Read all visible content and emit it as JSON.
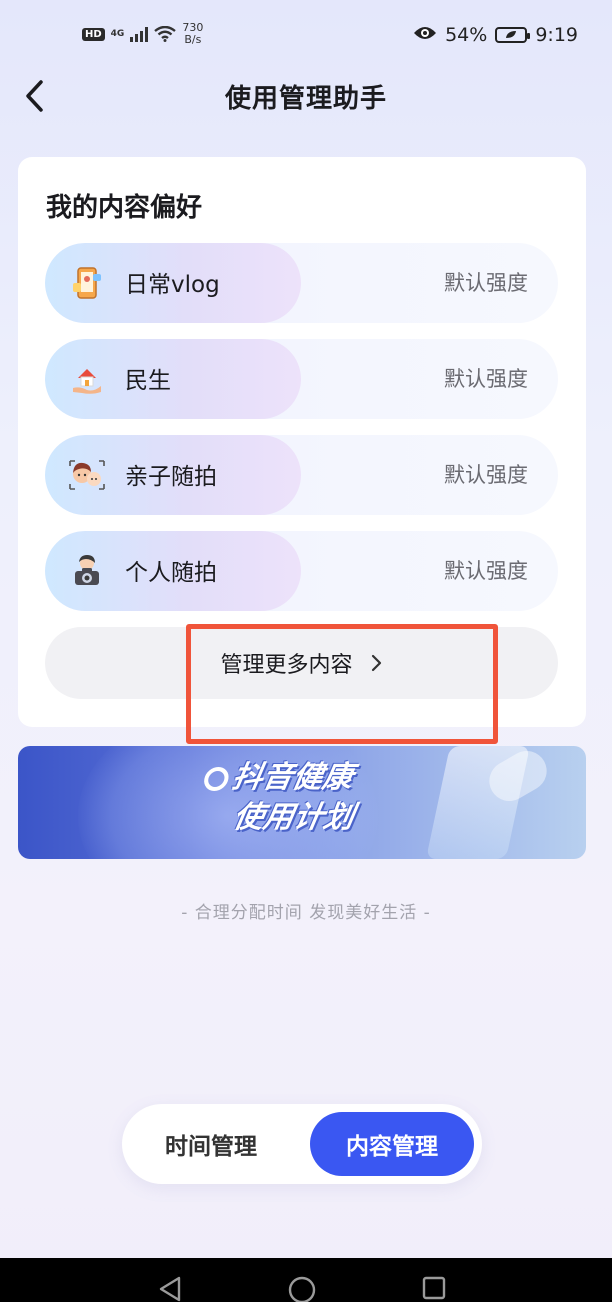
{
  "status_bar": {
    "hd": "HD",
    "network": "4G",
    "speed_value": "730",
    "speed_unit": "B/s",
    "battery": "54%",
    "time": "9:19",
    "icons": [
      "signal-icon",
      "wifi-icon",
      "eye-icon",
      "battery-icon"
    ]
  },
  "nav": {
    "title": "使用管理助手",
    "back_icon": "chevron-left-icon"
  },
  "preferences": {
    "title": "我的内容偏好",
    "items": [
      {
        "label": "日常vlog",
        "strength": "默认强度",
        "icon": "phone-vlog-icon"
      },
      {
        "label": "民生",
        "strength": "默认强度",
        "icon": "house-hand-icon"
      },
      {
        "label": "亲子随拍",
        "strength": "默认强度",
        "icon": "parent-child-icon"
      },
      {
        "label": "个人随拍",
        "strength": "默认强度",
        "icon": "camera-person-icon"
      }
    ],
    "more_label": "管理更多内容",
    "more_icon": "chevron-right-icon"
  },
  "banner": {
    "line1": "抖音健康",
    "line2": "使用计划"
  },
  "slogan": "- 合理分配时间 发现美好生活 -",
  "tabs": {
    "time": "时间管理",
    "content": "内容管理",
    "active": "content"
  },
  "colors": {
    "accent": "#3a57f2",
    "highlight": "#f0543a"
  }
}
